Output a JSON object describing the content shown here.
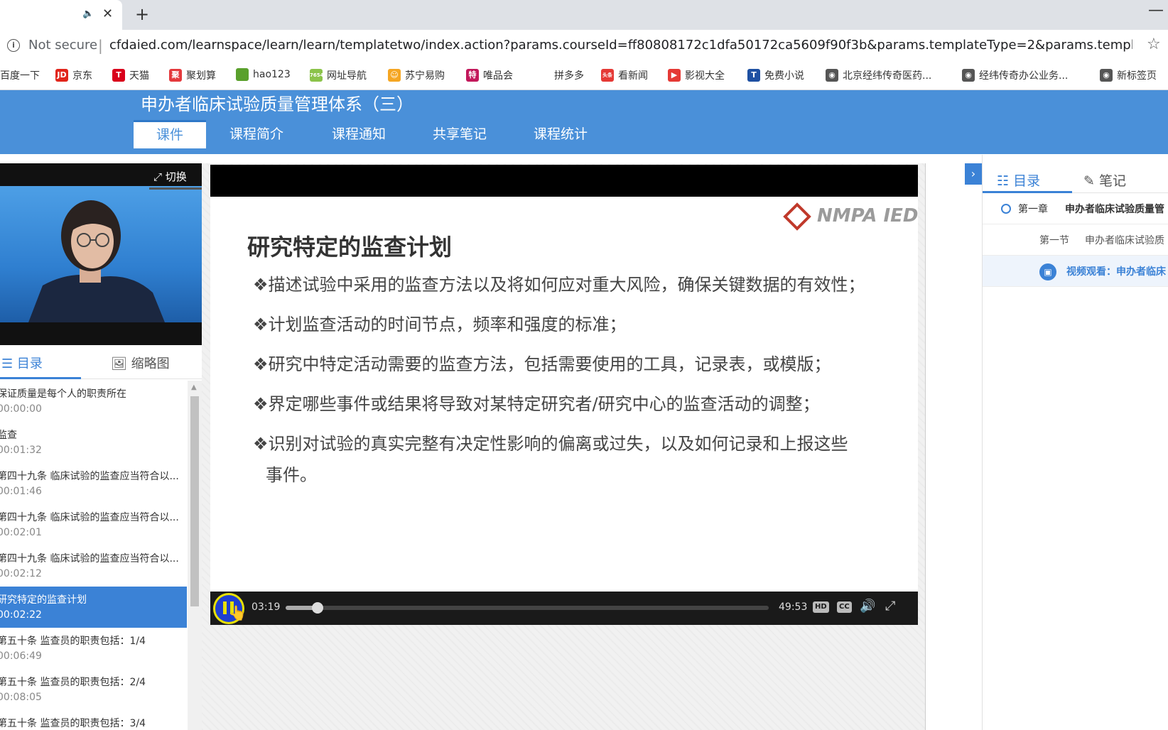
{
  "browser": {
    "url_status": "Not secure",
    "url_separator": "|",
    "url": "cfdaied.com/learnspace/learn/learn/templatetwo/index.action?params.courseId=ff80808172c1dfa50172ca5609f90f3b&params.templateType=2&params.templateStyleTy...",
    "new_tab": "+",
    "close_tab": "✕",
    "info": "i",
    "audio": "🔈",
    "star": "☆",
    "minimize": "—"
  },
  "bookmarks": [
    {
      "label": "百度一下",
      "icon_text": "",
      "color": "#2932e1"
    },
    {
      "label": "京东",
      "icon_text": "JD",
      "color": "#e1251b"
    },
    {
      "label": "天猫",
      "icon_text": "T",
      "color": "#d9001b"
    },
    {
      "label": "聚划算",
      "icon_text": "聚",
      "color": "#e4393c"
    },
    {
      "label": "hao123",
      "icon_text": "",
      "color": "#5aa02c"
    },
    {
      "label": "网址导航",
      "icon_text": "7654",
      "color": "#8bc34a"
    },
    {
      "label": "苏宁易购",
      "icon_text": "☺",
      "color": "#f5a623"
    },
    {
      "label": "唯品会",
      "icon_text": "特",
      "color": "#c2185b"
    },
    {
      "label": "拼多多",
      "icon_text": "",
      "color": "#ffffff"
    },
    {
      "label": "看新闻",
      "icon_text": "头条",
      "color": "#e53935"
    },
    {
      "label": "影视大全",
      "icon_text": "▶",
      "color": "#e53935"
    },
    {
      "label": "免费小说",
      "icon_text": "T",
      "color": "#1e50a2"
    },
    {
      "label": "北京经纬传奇医药...",
      "icon_text": "◉",
      "color": "#555555"
    },
    {
      "label": "经纬传奇办公业务...",
      "icon_text": "◉",
      "color": "#555555"
    },
    {
      "label": "新标签页",
      "icon_text": "◉",
      "color": "#555555"
    }
  ],
  "site": {
    "course_title": "申办者临床试验质量管理体系（三）",
    "nav_tabs": [
      "课件",
      "课程简介",
      "课程通知",
      "共享笔记",
      "课程统计"
    ],
    "primary_color": "#4a90d9"
  },
  "left_panel": {
    "switch_label": "切换",
    "switch_icon": "⤢",
    "tabs": [
      {
        "label": "目录",
        "icon": "☰"
      },
      {
        "label": "缩略图",
        "icon": "🖼"
      }
    ],
    "scroll_up": "▲",
    "toc": [
      {
        "title": "保证质量是每个人的职责所在",
        "time": "00:00:00"
      },
      {
        "title": "监查",
        "time": "00:01:32"
      },
      {
        "title": "第四十九条 临床试验的监查应当符合以...",
        "time": "00:01:46"
      },
      {
        "title": "第四十九条 临床试验的监查应当符合以...",
        "time": "00:02:01"
      },
      {
        "title": "第四十九条 临床试验的监查应当符合以...",
        "time": "00:02:12"
      },
      {
        "title": "研究特定的监查计划",
        "time": "00:02:22",
        "active": true
      },
      {
        "title": "第五十条 监查员的职责包括：1/4",
        "time": "00:06:49"
      },
      {
        "title": "第五十条 监查员的职责包括：2/4",
        "time": "00:08:05"
      },
      {
        "title": "第五十条 监查员的职责包括：3/4",
        "time": ""
      }
    ]
  },
  "slide": {
    "logo": "NMPA IED",
    "heading": "研究特定的监查计划",
    "bullets": [
      "❖描述试验中采用的监查方法以及将如何应对重大风险，确保关键数据的有效性；",
      "❖计划监查活动的时间节点，频率和强度的标准；",
      "❖研究中特定活动需要的监查方法，包括需要使用的工具，记录表，或模版；",
      "❖界定哪些事件或结果将导致对某特定研究者/研究中心的监查活动的调整；",
      "❖识别对试验的真实完整有决定性影响的偏离或过失，以及如何记录和上报这些"
    ],
    "bullet_continuation": "事件。"
  },
  "player": {
    "current_time": "03:19",
    "total_time": "49:53",
    "progress": 0.066,
    "hd_label": "HD",
    "cc_label": "CC",
    "volume_icon": "🔊",
    "fullscreen_icon": "⤢",
    "cursor_icon": "👆"
  },
  "right_panel": {
    "toggle_icon": "›",
    "tabs": [
      {
        "label": "目录",
        "icon": "☷"
      },
      {
        "label": "笔记",
        "icon": "✎"
      }
    ],
    "chapter_label": "第一章",
    "chapter_title": "申办者临床试验质量管",
    "section_label": "第一节",
    "section_title": "申办者临床试验质",
    "video_label": "视频观看：申办者临床",
    "video_icon": "▣"
  }
}
